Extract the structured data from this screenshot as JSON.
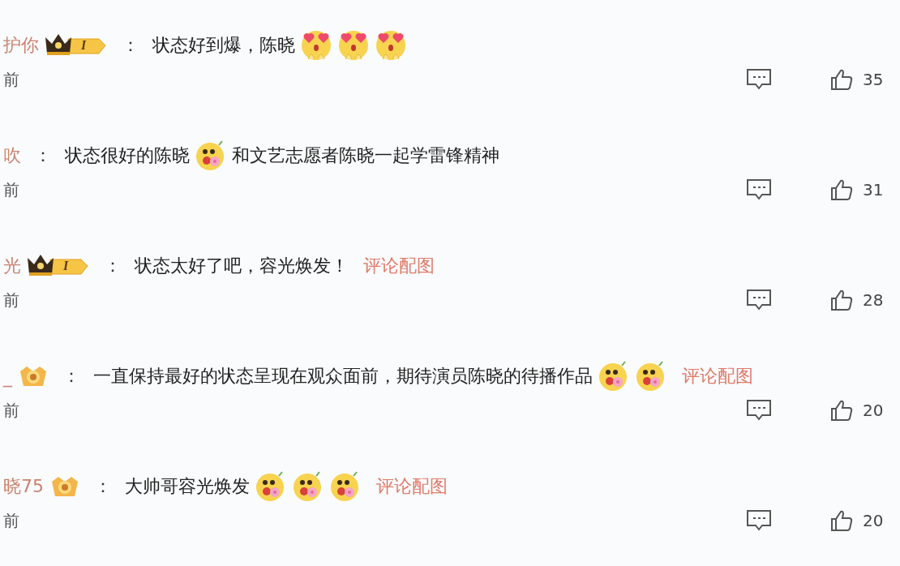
{
  "comments": [
    {
      "name": "护你",
      "badge": {
        "kind": "crown",
        "level": "I"
      },
      "colon": "：",
      "content": [
        {
          "kind": "text",
          "text": "状态好到爆，陈晓"
        },
        {
          "kind": "heart-eyes-emoji"
        },
        {
          "kind": "heart-eyes-emoji"
        },
        {
          "kind": "heart-eyes-emoji"
        }
      ],
      "time": "前",
      "likes": "35"
    },
    {
      "name": "吹",
      "colon": "：",
      "content": [
        {
          "kind": "text",
          "text": "状态很好的陈晓"
        },
        {
          "kind": "flower-emoji"
        },
        {
          "kind": "text",
          "text": "和文艺志愿者陈晓一起学雷锋精神"
        }
      ],
      "time": "前",
      "likes": "31"
    },
    {
      "name": "光",
      "badge": {
        "kind": "crown",
        "level": "I"
      },
      "colon": "：",
      "content": [
        {
          "kind": "text",
          "text": "状态太好了吧，容光焕发！"
        },
        {
          "kind": "link",
          "text": "评论配图"
        }
      ],
      "time": "前",
      "likes": "28"
    },
    {
      "name": "_",
      "badge": {
        "kind": "medal"
      },
      "colon": "：",
      "content": [
        {
          "kind": "text",
          "text": "一直保持最好的状态呈现在观众面前，期待演员陈晓的待播作品"
        },
        {
          "kind": "flower-emoji"
        },
        {
          "kind": "flower-emoji"
        },
        {
          "kind": "link",
          "text": "评论配图"
        }
      ],
      "time": "前",
      "likes": "20"
    },
    {
      "name": "晓75",
      "badge": {
        "kind": "medal"
      },
      "colon": "：",
      "content": [
        {
          "kind": "text",
          "text": "大帅哥容光焕发"
        },
        {
          "kind": "flower-emoji"
        },
        {
          "kind": "flower-emoji"
        },
        {
          "kind": "flower-emoji"
        },
        {
          "kind": "link",
          "text": "评论配图"
        }
      ],
      "time": "前",
      "likes": "20"
    }
  ]
}
